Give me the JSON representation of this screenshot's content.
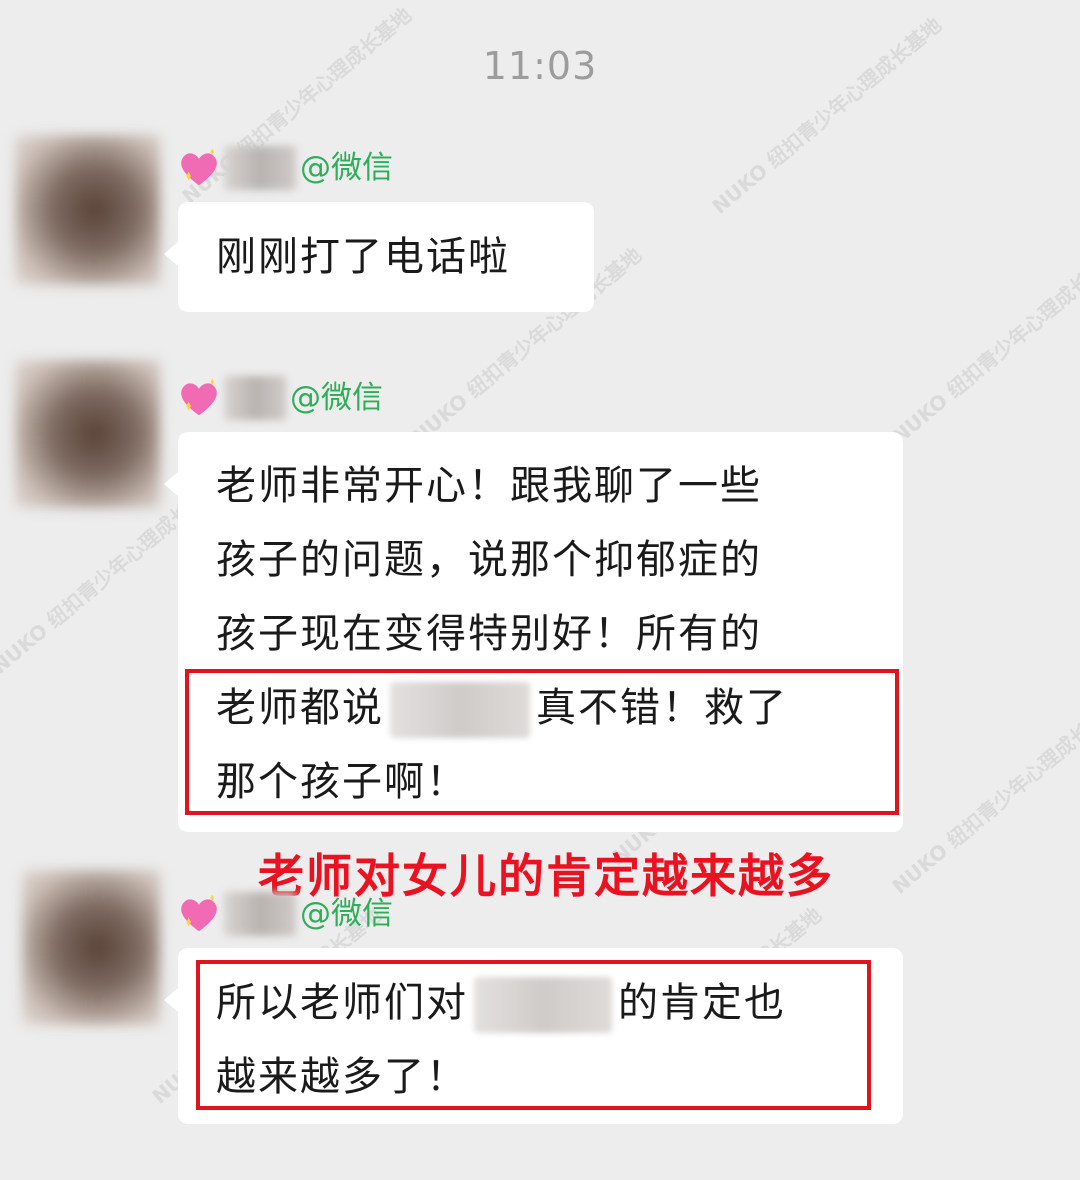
{
  "timestamp": "11:03",
  "sender_suffix": "@微信",
  "watermark": "NUKO 纽扣青少年心理成长基地",
  "messages": [
    {
      "lines": [
        "刚刚打了电话啦"
      ]
    },
    {
      "lines": [
        "老师非常开心！跟我聊了一些",
        "孩子的问题，说那个抑郁症的",
        "孩子现在变得特别好！所有的",
        "老师都说",
        "真不错！救了",
        "那个孩子啊！"
      ]
    },
    {
      "lines": [
        "所以老师们对",
        "的肯定也",
        "越来越多了！"
      ]
    }
  ],
  "annotation": "老师对女儿的肯定越来越多",
  "colors": {
    "annotation": "#ea1221",
    "highlight_box": "#e0141e",
    "wechat_tag": "#2fae5a",
    "background": "#ededed"
  }
}
